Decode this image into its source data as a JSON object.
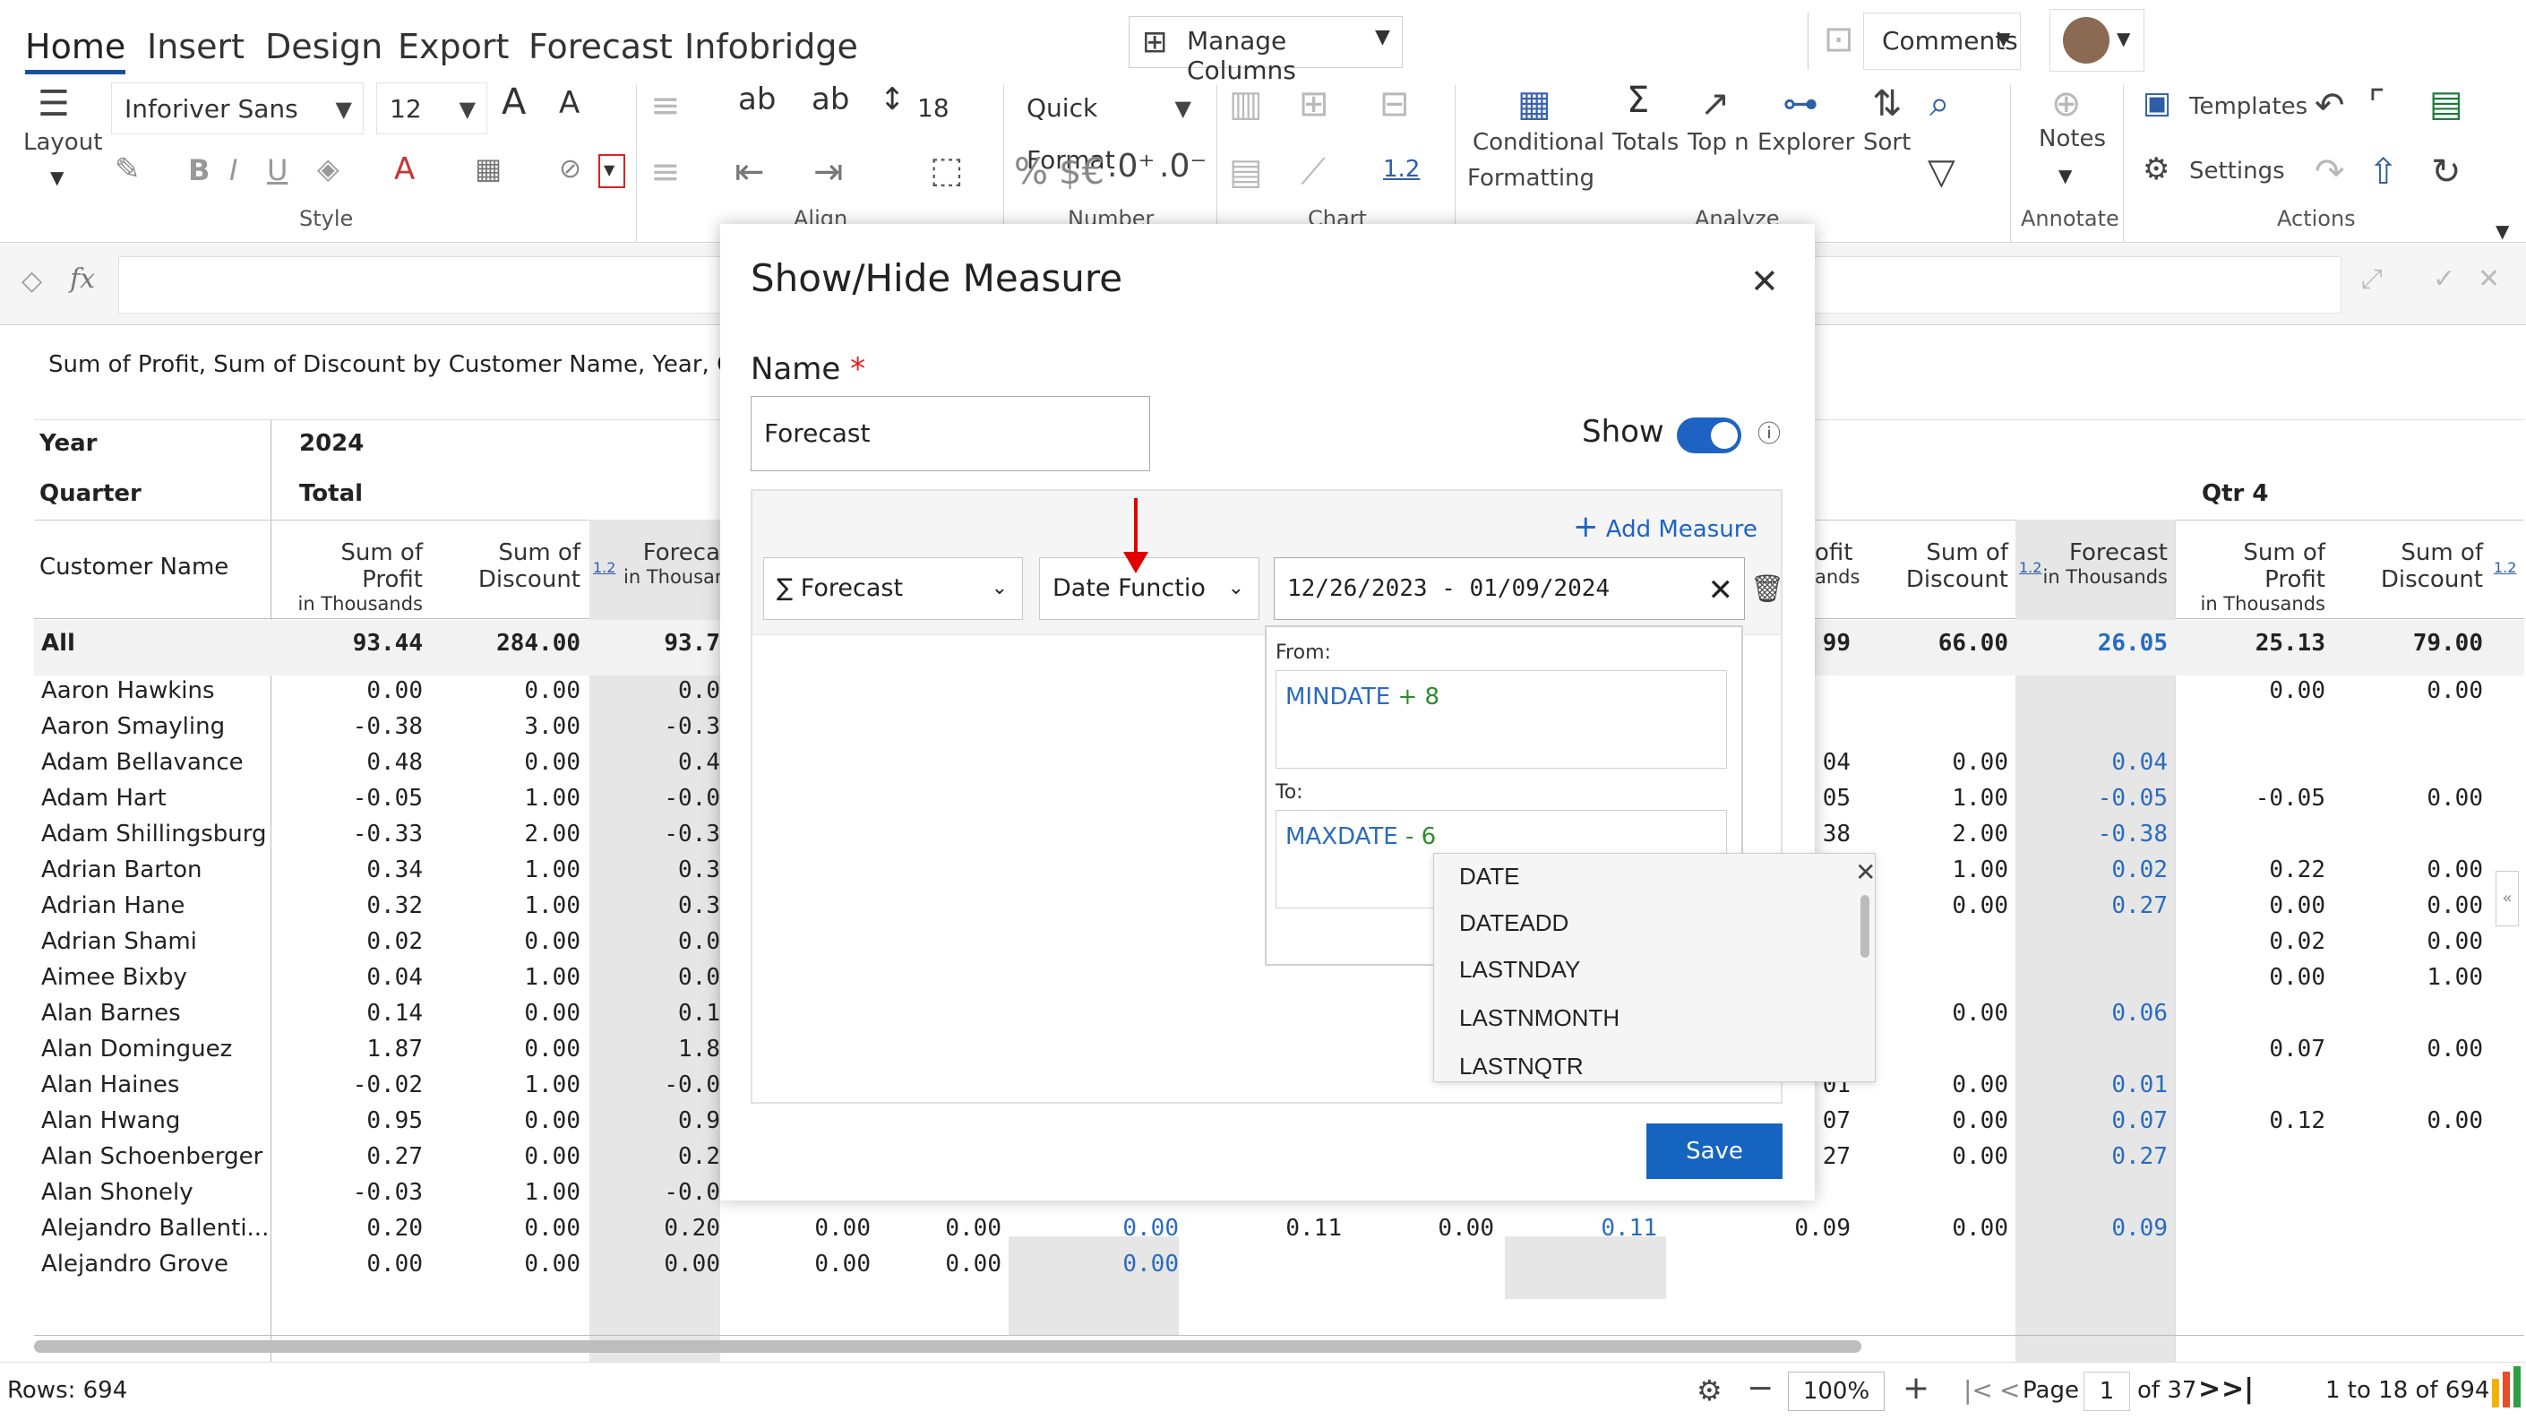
{
  "tabs": [
    "Home",
    "Insert",
    "Design",
    "Export",
    "Forecast",
    "Infobridge"
  ],
  "ribbon": {
    "manage_columns": "Manage Columns",
    "comments": "Comments",
    "layout": "Layout",
    "font_name": "Inforiver Sans",
    "font_size": "12",
    "row_height": "18",
    "quick_format": "Quick Format",
    "conditional": "Conditional",
    "formatting": "Formatting",
    "totals": "Totals",
    "topn": "Top n",
    "explorer": "Explorer",
    "sort": "Sort",
    "notes": "Notes",
    "templates": "Templates",
    "settings": "Settings",
    "decimal_label": "1.2",
    "group_style": "Style",
    "group_align": "Align",
    "group_number": "Number",
    "group_chart": "Chart",
    "group_analyze": "Analyze",
    "group_annotate": "Annotate",
    "group_actions": "Actions"
  },
  "formula": {
    "fx": "fx"
  },
  "grid": {
    "title": "Sum of Profit, Sum of Discount by Customer Name, Year, Quarter",
    "year_label": "Year",
    "quarter_label": "Quarter",
    "year_value": "2024",
    "quarter_value": "Total",
    "qtr4": "Qtr 4",
    "customer_name": "Customer Name",
    "col_profit_1": "Sum of Profit",
    "col_profit_2": "in Thousands",
    "col_disc_1": "Sum of",
    "col_disc_2": "Discount",
    "col_fc_1": "Forecast",
    "col_fc_2": "in Thousands",
    "col_fc_trunc_1": "Foreca",
    "col_fc_trunc_2": "in Thousan",
    "col_ofit": "ofit",
    "col_ands": "ands",
    "badge": "1.2",
    "rows": [
      {
        "name": "All",
        "c1": "93.44",
        "c2": "284.00",
        "c3": "93.7",
        "r1": "99",
        "r2": "66.00",
        "r3": "26.05",
        "q1": "25.13",
        "q2": "79.00"
      },
      {
        "name": "Aaron Hawkins",
        "c1": "0.00",
        "c2": "0.00",
        "c3": "0.0",
        "r1": "",
        "r2": "",
        "r3": "",
        "q1": "0.00",
        "q2": "0.00"
      },
      {
        "name": "Aaron Smayling",
        "c1": "-0.38",
        "c2": "3.00",
        "c3": "-0.3",
        "r1": "",
        "r2": "",
        "r3": "",
        "q1": "",
        "q2": ""
      },
      {
        "name": "Adam Bellavance",
        "c1": "0.48",
        "c2": "0.00",
        "c3": "0.4",
        "r1": "04",
        "r2": "0.00",
        "r3": "0.04",
        "q1": "",
        "q2": ""
      },
      {
        "name": "Adam Hart",
        "c1": "-0.05",
        "c2": "1.00",
        "c3": "-0.0",
        "r1": "05",
        "r2": "1.00",
        "r3": "-0.05",
        "q1": "-0.05",
        "q2": "0.00"
      },
      {
        "name": "Adam Shillingsburg",
        "c1": "-0.33",
        "c2": "2.00",
        "c3": "-0.3",
        "r1": "38",
        "r2": "2.00",
        "r3": "-0.38",
        "q1": "",
        "q2": ""
      },
      {
        "name": "Adrian Barton",
        "c1": "0.34",
        "c2": "1.00",
        "c3": "0.3",
        "r1": "",
        "r2": "1.00",
        "r3": "0.02",
        "q1": "0.22",
        "q2": "0.00"
      },
      {
        "name": "Adrian Hane",
        "c1": "0.32",
        "c2": "1.00",
        "c3": "0.3",
        "r1": "",
        "r2": "0.00",
        "r3": "0.27",
        "q1": "0.00",
        "q2": "0.00"
      },
      {
        "name": "Adrian Shami",
        "c1": "0.02",
        "c2": "0.00",
        "c3": "0.0",
        "r1": "",
        "r2": "",
        "r3": "",
        "q1": "0.02",
        "q2": "0.00"
      },
      {
        "name": "Aimee Bixby",
        "c1": "0.04",
        "c2": "1.00",
        "c3": "0.0",
        "r1": "",
        "r2": "",
        "r3": "",
        "q1": "0.00",
        "q2": "1.00"
      },
      {
        "name": "Alan Barnes",
        "c1": "0.14",
        "c2": "0.00",
        "c3": "0.1",
        "r1": "",
        "r2": "0.00",
        "r3": "0.06",
        "q1": "",
        "q2": ""
      },
      {
        "name": "Alan Dominguez",
        "c1": "1.87",
        "c2": "0.00",
        "c3": "1.8",
        "r1": "",
        "r2": "",
        "r3": "",
        "q1": "0.07",
        "q2": "0.00"
      },
      {
        "name": "Alan Haines",
        "c1": "-0.02",
        "c2": "1.00",
        "c3": "-0.0",
        "r1": "01",
        "r2": "0.00",
        "r3": "0.01",
        "q1": "",
        "q2": ""
      },
      {
        "name": "Alan Hwang",
        "c1": "0.95",
        "c2": "0.00",
        "c3": "0.9",
        "r1": "07",
        "r2": "0.00",
        "r3": "0.07",
        "q1": "0.12",
        "q2": "0.00"
      },
      {
        "name": "Alan Schoenberger",
        "c1": "0.27",
        "c2": "0.00",
        "c3": "0.2",
        "r1": "27",
        "r2": "0.00",
        "r3": "0.27",
        "q1": "",
        "q2": ""
      },
      {
        "name": "Alan Shonely",
        "c1": "-0.03",
        "c2": "1.00",
        "c3": "-0.0",
        "r1": "",
        "r2": "",
        "r3": "",
        "q1": "",
        "q2": ""
      },
      {
        "name": "Alejandro Ballenti...",
        "c1": "0.20",
        "c2": "0.00",
        "c3": "0.20",
        "m1": "0.00",
        "m2": "0.00",
        "m3": "0.00",
        "m4": "0.11",
        "m5": "0.00",
        "m6": "0.11",
        "r1": "0.09",
        "r2": "0.00",
        "r3": "0.09",
        "q1": "",
        "q2": ""
      },
      {
        "name": "Alejandro Grove",
        "c1": "0.00",
        "c2": "0.00",
        "c3": "0.00",
        "m1": "0.00",
        "m2": "0.00",
        "m3": "0.00",
        "r1": "",
        "r2": "",
        "r3": "",
        "q1": "",
        "q2": ""
      }
    ]
  },
  "status": {
    "rows": "Rows: 694",
    "zoom": "100%",
    "page_label": "Page",
    "page_value": "1",
    "of_pages": "of 37",
    "range": "1 to 18 of 694"
  },
  "dialog": {
    "title": "Show/Hide Measure",
    "name_label": "Name",
    "required": "*",
    "name_value": "Forecast",
    "show_label": "Show",
    "show_on": true,
    "add_measure": "Add Measure",
    "measure_select": "∑ Forecast",
    "function_select": "Date Functio",
    "date_range": "12/26/2023 - 01/09/2024",
    "from_label": "From:",
    "from_fn": "MINDATE",
    "from_op": "+ 8",
    "to_label": "To:",
    "to_fn": "MAXDATE",
    "to_op": "- 6",
    "suggestions": [
      "DATE",
      "DATEADD",
      "LASTNDAY",
      "LASTNMONTH",
      "LASTNQTR"
    ],
    "save": "Save"
  },
  "colors": {
    "accent": "#1a4fa0",
    "forecast_text": "#2a6bbf",
    "save_bg": "#1565c0",
    "toggle": "#1e63c4",
    "arrow": "#e00000"
  }
}
